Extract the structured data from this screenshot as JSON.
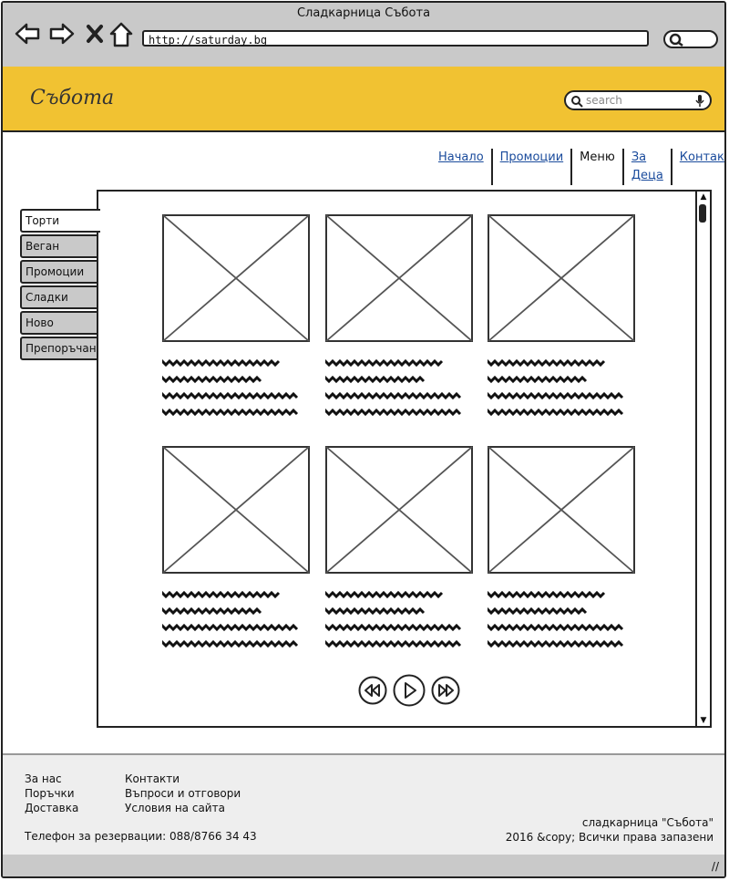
{
  "window": {
    "title": "Сладкарница Събота"
  },
  "browser": {
    "url": "http://saturday.bg"
  },
  "header": {
    "logo": "Събота",
    "search_placeholder": "search"
  },
  "topnav": [
    {
      "label": "Начало",
      "link": true
    },
    {
      "label": "Промоции",
      "link": true
    },
    {
      "label": "Меню",
      "link": false
    },
    {
      "label": "За Деца",
      "link": true
    },
    {
      "label": "Контакти",
      "link": true
    }
  ],
  "tabs": [
    {
      "label": "Торти",
      "active": true
    },
    {
      "label": "Веган",
      "active": false
    },
    {
      "label": "Промоции",
      "active": false
    },
    {
      "label": "Сладки",
      "active": false
    },
    {
      "label": "Ново",
      "active": false
    },
    {
      "label": "Препоръчано",
      "active": false
    }
  ],
  "footer": {
    "col1": [
      "За нас",
      "Поръчки",
      "Доставка"
    ],
    "col2": [
      "Контакти",
      "Въпроси и отговори",
      "Условия на сайта"
    ],
    "phone": "Телефон за резервации: 088/8766 34 43",
    "copyright_line1": "сладкарница \"Събота\"",
    "copyright_line2": "2016 &copy; Всички права запазени"
  },
  "colors": {
    "header": "#f1c232",
    "chrome": "#c9c9c9",
    "link": "#1a4b9c"
  }
}
